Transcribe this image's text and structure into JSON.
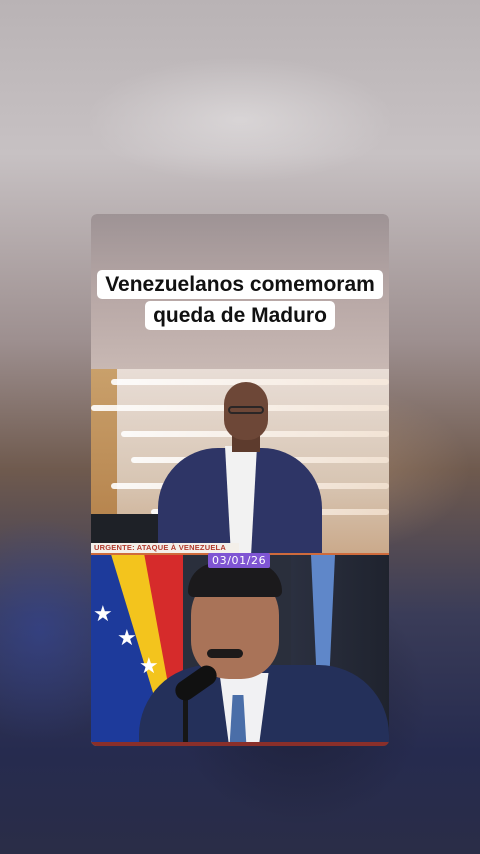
{
  "video": {
    "headline": "Venezuelanos comemoram queda de Maduro",
    "ticker": "URGENTE: ATAQUE À VENEZUELA",
    "date": "03/01/26"
  },
  "colors": {
    "headline_bg": "#ffffff",
    "date_badge": "#7f55d3",
    "ticker_text": "#b13b2e"
  }
}
